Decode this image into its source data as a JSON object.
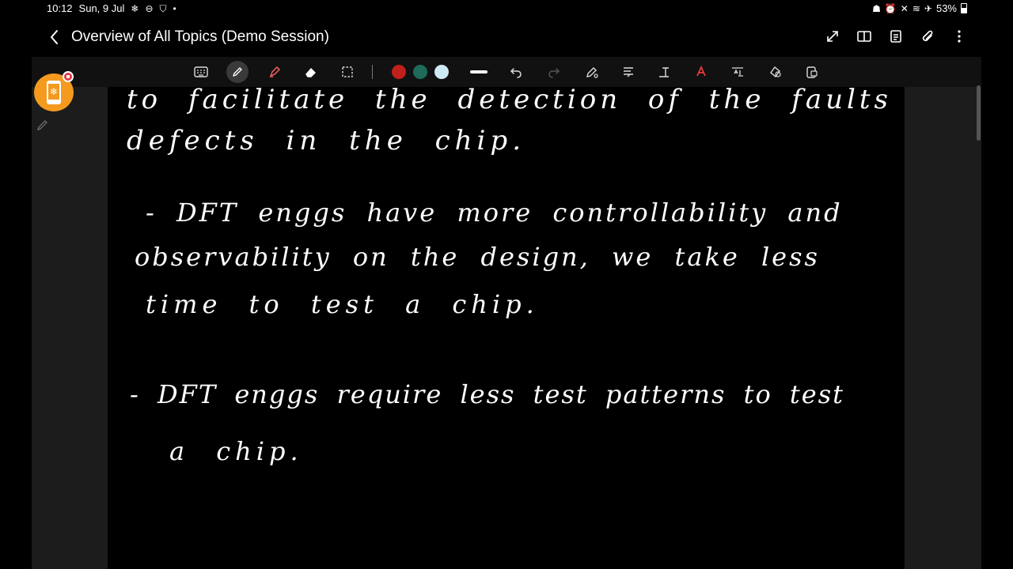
{
  "status_bar": {
    "time": "10:12",
    "date": "Sun, 9 Jul",
    "left_icons": [
      "snowflake-icon",
      "dnd-icon",
      "shield-icon",
      "dot-icon"
    ],
    "right_icons": [
      "ghost-icon",
      "alarm-icon",
      "mute-icon",
      "wifi-icon",
      "airplane-icon"
    ],
    "battery": "53%"
  },
  "title_bar": {
    "title": "Overview of All Topics (Demo Session)",
    "actions": [
      "expand-icon",
      "book-view-icon",
      "page-layout-icon",
      "attach-icon",
      "more-options-icon"
    ]
  },
  "toolbar": {
    "tools": [
      "keyboard-icon",
      "pen-icon",
      "highlighter-icon",
      "eraser-icon",
      "lasso-select-icon"
    ],
    "colors": [
      "#c0201b",
      "#1e6b5a",
      "#cfeaf7"
    ],
    "actions": [
      "undo-icon",
      "redo-icon",
      "pen-settings-icon",
      "text-align-icon",
      "text-format-icon",
      "text-color-icon",
      "straighten-text-icon",
      "shapes-icon",
      "lock-icon"
    ]
  },
  "note": {
    "lines": [
      "to facilitate the detection of the faults",
      "defects in the chip.",
      "- DFT enggs have more controllability and",
      "observability on the design, we take less",
      "time to test a chip.",
      "- DFT enggs require less test patterns to test",
      "a chip."
    ]
  }
}
